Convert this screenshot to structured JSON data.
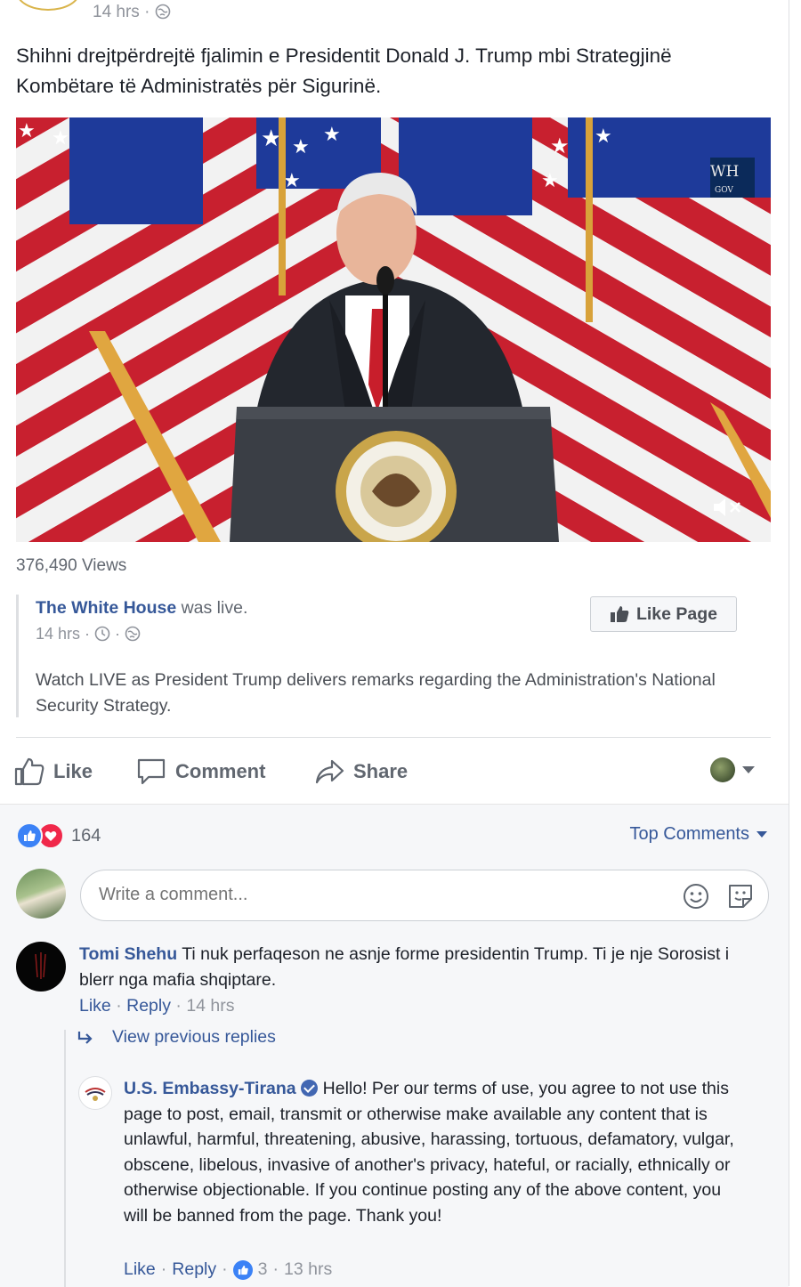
{
  "post": {
    "time": "14 hrs · ",
    "text": "Shihni drejtpërdrejtë fjalimin e Presidentit Donald J. Trump mbi Strategjinë Kombëtare të Administratës për Sigurinë.",
    "video": {
      "watermark_line1": "WH",
      "watermark_line2": "GOV",
      "muted": true
    },
    "views": "376,490 Views"
  },
  "shared": {
    "page_name": "The White House",
    "status": " was live.",
    "time": "14 hrs · ",
    "text": "Watch LIVE as President Trump delivers remarks regarding the Administration's National Security Strategy.",
    "like_page_label": "Like Page"
  },
  "actions": {
    "like": "Like",
    "comment": "Comment",
    "share": "Share"
  },
  "reactions": {
    "count": "164",
    "sort_label": "Top Comments"
  },
  "composer": {
    "placeholder": "Write a comment..."
  },
  "comments": [
    {
      "author": "Tomi Shehu",
      "text": " Ti nuk perfaqeson ne asnje forme presidentin Trump. Ti je nje Sorosist i blerr nga mafia shqiptare.",
      "like": "Like",
      "reply": "Reply",
      "time": "14 hrs"
    }
  ],
  "view_previous": "View previous replies",
  "reply": {
    "author": "U.S. Embassy-Tirana",
    "verified": true,
    "text": "Hello! Per our terms of use, you agree to not use this page to post, email, transmit or otherwise make available any content that is unlawful, harmful, threatening, abusive, harassing, tortuous, defamatory, vulgar, obscene, libelous, invasive of another's privacy, hateful, or racially, ethnically or otherwise objectionable. If you continue posting any of the above content, you will be banned from the page. Thank you!",
    "like": "Like",
    "reply": "Reply",
    "likes": "3",
    "time": "13 hrs"
  },
  "colors": {
    "link": "#365899",
    "muted": "#90949c",
    "like_blue": "#3b82f6",
    "love_red": "#f0284a"
  }
}
